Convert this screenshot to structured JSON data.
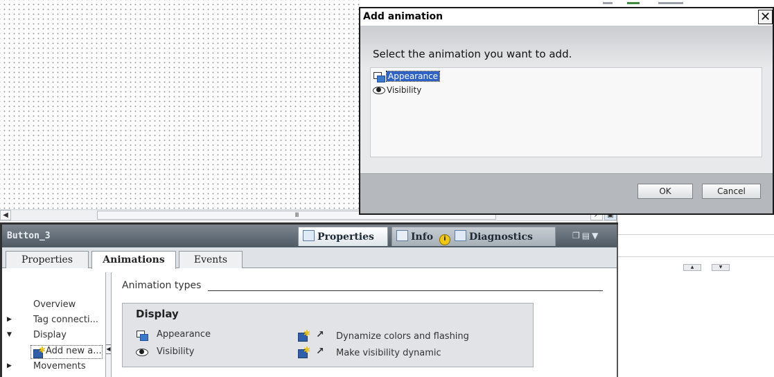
{
  "canvas": {
    "scroll_thumb_glyph": "III"
  },
  "inspector": {
    "object_name": "Button_3",
    "panel_tabs": [
      {
        "label": "Properties"
      },
      {
        "label": "Info"
      },
      {
        "label": "Diagnostics"
      }
    ],
    "sub_tabs": [
      {
        "label": "Properties"
      },
      {
        "label": "Animations"
      },
      {
        "label": "Events"
      }
    ],
    "nav": {
      "items": [
        {
          "label": "Overview"
        },
        {
          "label": "Tag connecti..."
        },
        {
          "label": "Display"
        },
        {
          "label": "Add new a..."
        },
        {
          "label": "Movements"
        }
      ]
    },
    "content": {
      "section_label": "Animation types",
      "group_title": "Display",
      "types": [
        {
          "label": "Appearance",
          "icon": "appearance-icon"
        },
        {
          "label": "Visibility",
          "icon": "visibility-eye-icon"
        }
      ],
      "actions": [
        {
          "label": "Dynamize colors and flashing"
        },
        {
          "label": "Make visibility dynamic"
        }
      ]
    }
  },
  "dialog": {
    "title": "Add animation",
    "close_glyph": "✕",
    "prompt": "Select the animation you want to add.",
    "options": [
      {
        "label": "Appearance",
        "selected": true
      },
      {
        "label": "Visibility",
        "selected": false
      }
    ],
    "ok_label": "OK",
    "cancel_label": "Cancel"
  }
}
